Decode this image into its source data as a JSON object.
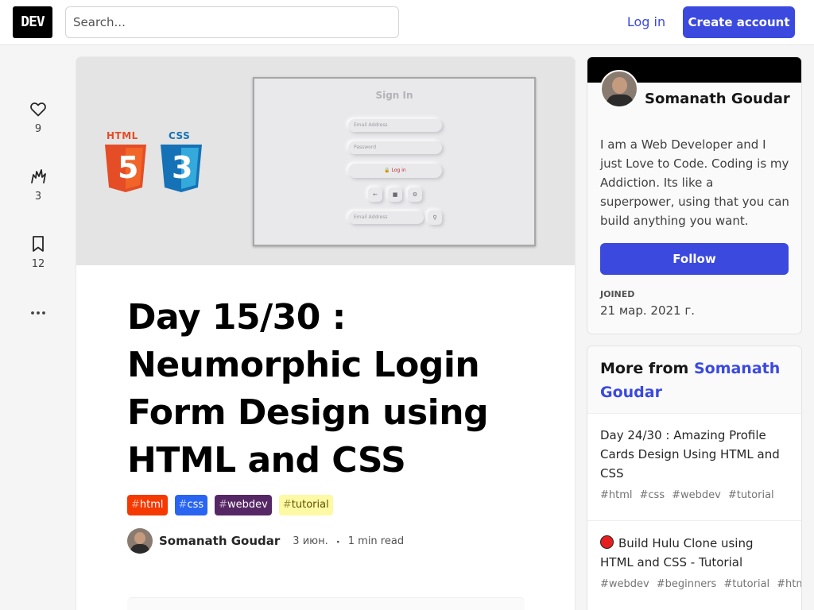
{
  "header": {
    "logo": "DEV",
    "search_placeholder": "Search...",
    "login": "Log in",
    "create_account": "Create account"
  },
  "reactions": {
    "hearts": "9",
    "unicorns": "3",
    "saves": "12"
  },
  "cover": {
    "html_label": "HTML",
    "html_number": "5",
    "css_label": "CSS",
    "css_number": "3",
    "mock_title": "Sign In",
    "email_placeholder": "Email Address",
    "password_placeholder": "Password",
    "login_button": "Log in",
    "email_placeholder_2": "Email Address"
  },
  "article": {
    "title": "Day 15/30 : Neumorphic Login Form Design using HTML and CSS",
    "tags": [
      {
        "hash": "#",
        "name": "html",
        "color": "#f53900"
      },
      {
        "hash": "#",
        "name": "css",
        "color": "#2965f1"
      },
      {
        "hash": "#",
        "name": "webdev",
        "color": "#562765"
      },
      {
        "hash": "#",
        "name": "tutorial",
        "color": "#fef9a5"
      }
    ],
    "author": "Somanath Goudar",
    "date": "3 июн.",
    "separator": "・",
    "read_time": "1 min read"
  },
  "profile": {
    "name": "Somanath Goudar",
    "bio": "I am a Web Developer and I just Love to Code. Coding is my Addiction. Its like a superpower, using that you can build anything you want.",
    "follow": "Follow",
    "joined_label": "JOINED",
    "joined_date": "21 мар. 2021 г."
  },
  "more_from": {
    "prefix": "More from",
    "author": "Somanath Goudar",
    "items": [
      {
        "title": "Day 24/30 : Amazing Profile Cards Design Using HTML and CSS",
        "tags": [
          "#html",
          "#css",
          "#webdev",
          "#tutorial"
        ]
      },
      {
        "title": "Build Hulu Clone using HTML and CSS - Tutorial",
        "tags": [
          "#webdev",
          "#beginners",
          "#tutorial",
          "#html"
        ]
      }
    ]
  },
  "colors": {
    "accent": "#3b49df",
    "html_orange": "#e44d26",
    "css_blue": "#1572b6"
  }
}
